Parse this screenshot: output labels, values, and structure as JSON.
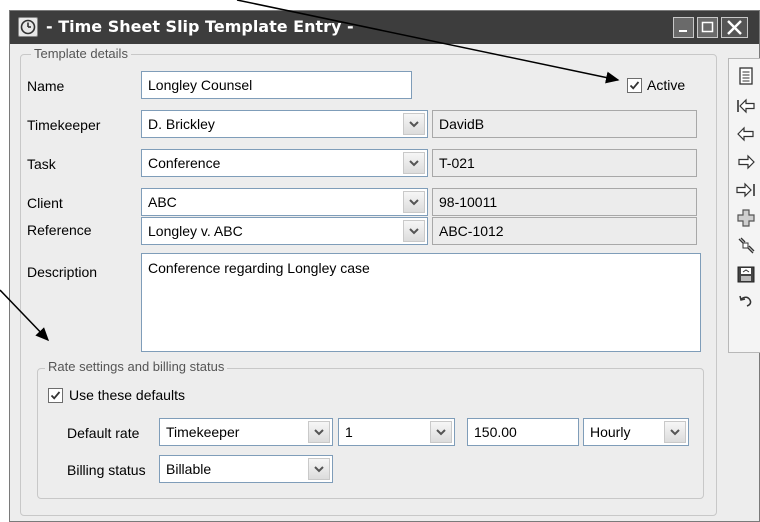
{
  "window": {
    "title": "- Time Sheet Slip Template Entry -"
  },
  "template": {
    "legend": "Template details",
    "name_label": "Name",
    "name_value": "Longley Counsel",
    "active_label": "Active",
    "active_checked": true,
    "timekeeper_label": "Timekeeper",
    "timekeeper_value": "D. Brickley",
    "timekeeper_code": "DavidB",
    "task_label": "Task",
    "task_value": "Conference",
    "task_code": "T-021",
    "client_label": "Client",
    "client_value": "ABC",
    "client_code": "98-10011",
    "reference_label": "Reference",
    "reference_value": "Longley v. ABC",
    "reference_code": "ABC-1012",
    "description_label": "Description",
    "description_value": "Conference regarding Longley case"
  },
  "rate": {
    "legend": "Rate settings and billing status",
    "use_defaults_label": "Use these defaults",
    "use_defaults_checked": true,
    "default_rate_label": "Default rate",
    "rate_source": "Timekeeper",
    "rate_level": "1",
    "rate_amount": "150.00",
    "rate_unit": "Hourly",
    "billing_status_label": "Billing status",
    "billing_status": "Billable"
  },
  "toolbar": {
    "icons": [
      "list-view-icon",
      "first-record-icon",
      "previous-record-icon",
      "next-record-icon",
      "last-record-icon",
      "add-record-icon",
      "lookup-icon",
      "save-icon",
      "undo-icon"
    ]
  }
}
